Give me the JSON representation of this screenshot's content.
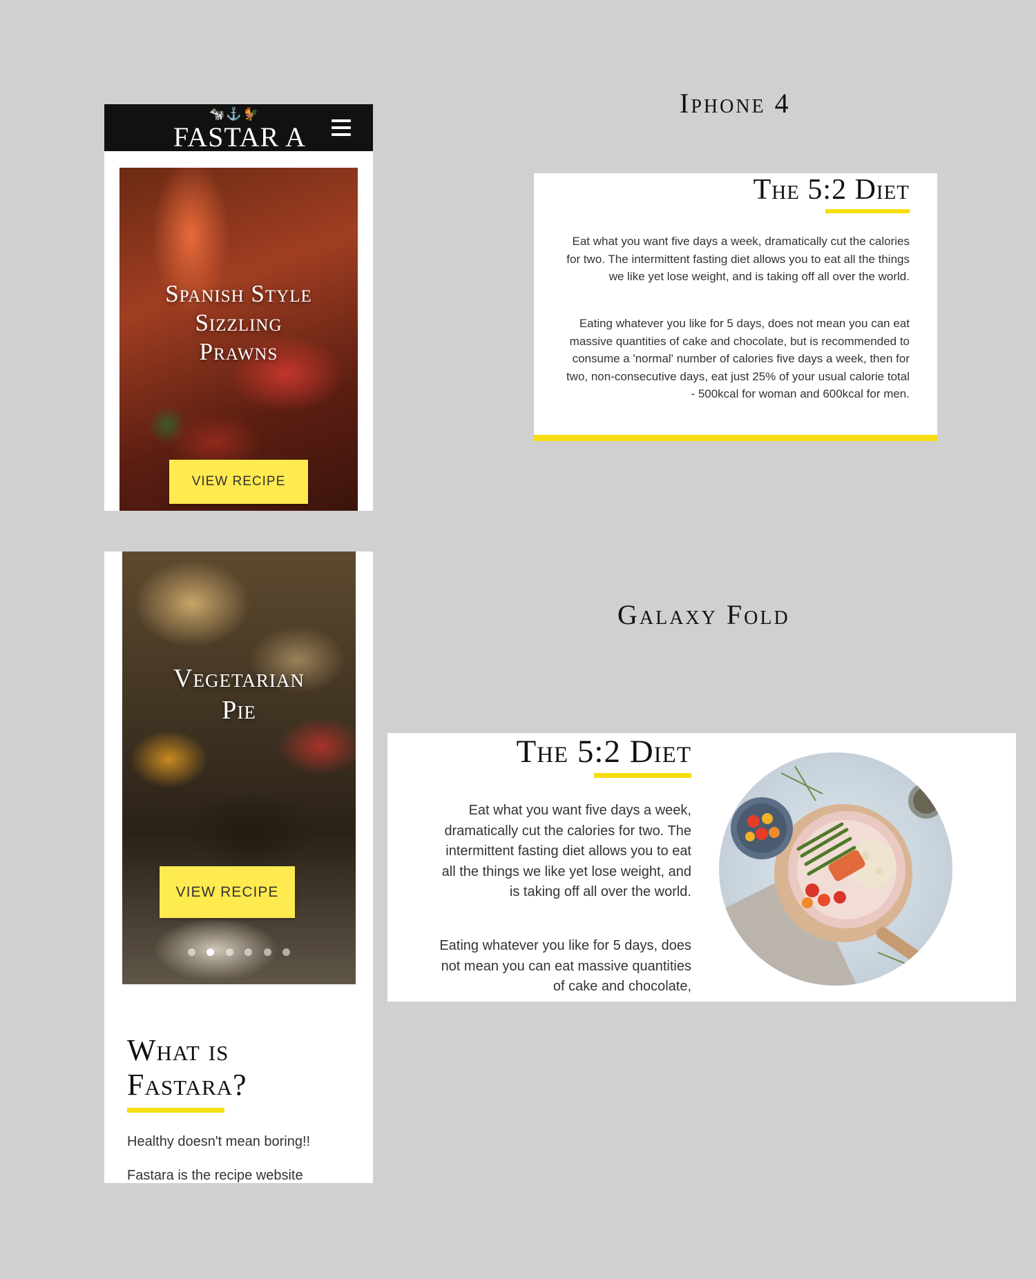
{
  "labels": {
    "iphone": "Iphone 4",
    "galaxy": "Galaxy Fold"
  },
  "navbar": {
    "logo_text": "FASTAR A",
    "logo_icons": "🐄⚓🐓"
  },
  "slides": [
    {
      "title_lines": [
        "Spanish Style",
        "Sizzling",
        "Prawns"
      ],
      "button": "VIEW RECIPE"
    },
    {
      "title_lines": [
        "Vegetarian",
        "Pie"
      ],
      "button": "VIEW RECIPE"
    }
  ],
  "carousel": {
    "count": 6,
    "active_index": 1
  },
  "diet": {
    "title": "The 5:2 Diet",
    "paragraph1": "Eat what you want five days a week, dramatically cut the calories for two. The intermittent fasting diet allows you to eat all the things we like yet lose weight, and is taking off all over the world.",
    "paragraph2": "Eating whatever you like for 5 days, does not mean you can eat massive quantities of cake and chocolate, but is recommended to consume a 'normal' number of calories five days a week, then for two, non-consecutive days, eat just 25% of your usual calorie total - 500kcal for woman and 600kcal for men.",
    "fold_paragraph1": "Eat what you want five days a week, dramatically cut the calories for two. The intermittent fasting diet allows you to eat all the things we like yet lose weight, and is taking off all over the world.",
    "fold_paragraph2": "Eating whatever you like for 5 days, does not mean you can eat massive quantities of cake and chocolate,"
  },
  "about": {
    "title_line1": "What is",
    "title_line2": "Fastara?",
    "p1": "Healthy doesn't mean boring!!",
    "p2": "Fastara is the recipe website"
  },
  "colors": {
    "accent_yellow": "#f6dd0f",
    "button_yellow": "#ffea4f",
    "navbar": "#111111",
    "background": "#d0d0d0"
  }
}
